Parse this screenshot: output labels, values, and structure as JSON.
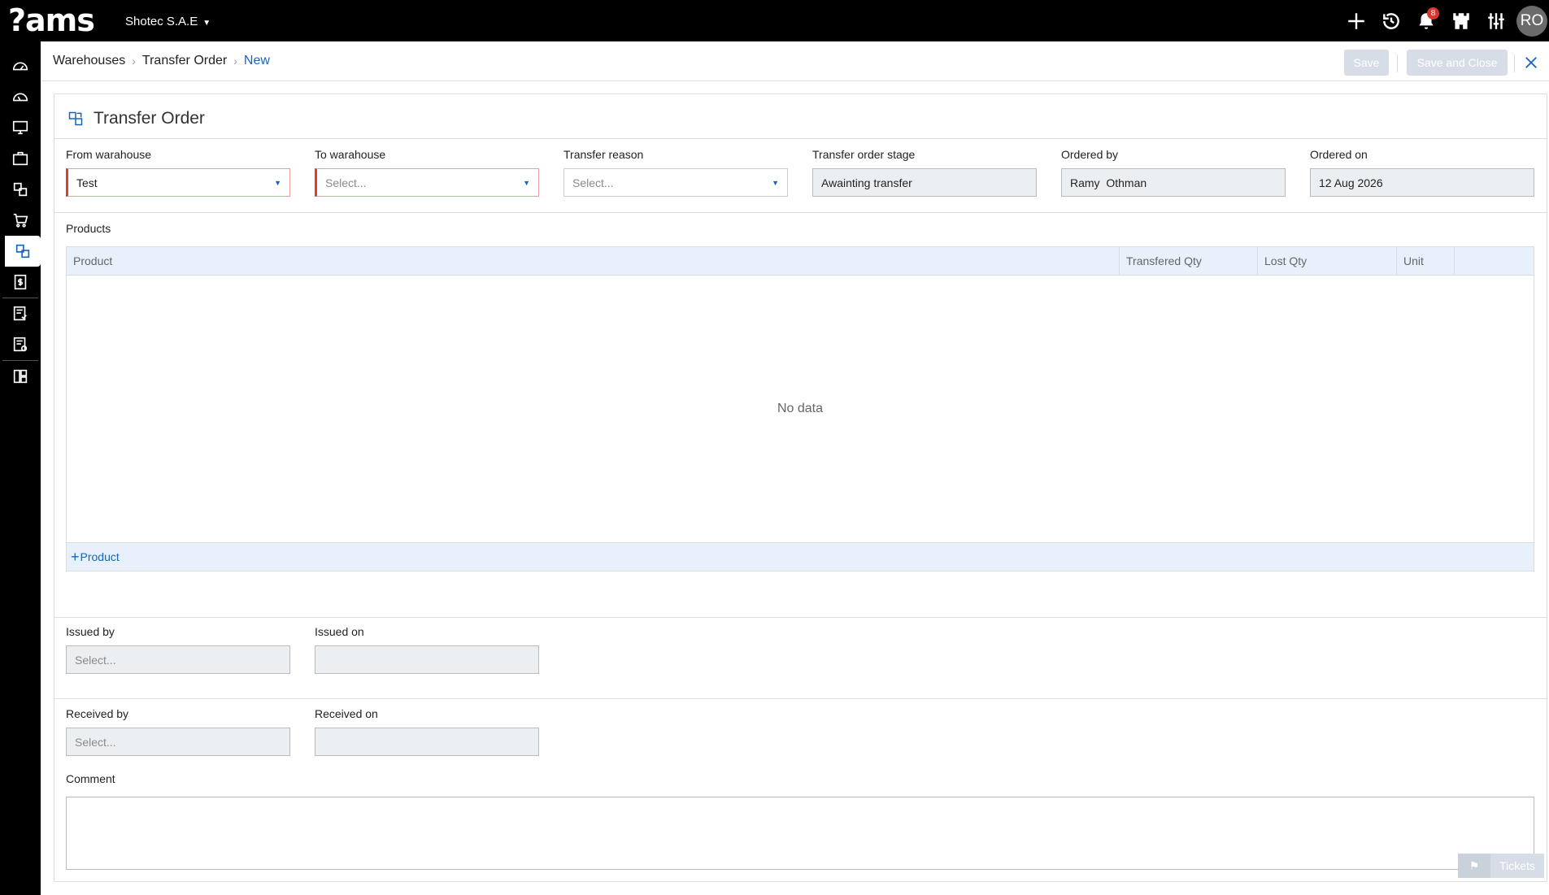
{
  "app": {
    "logo": "?ams",
    "company": "Shotec S.A.E",
    "avatar_initials": "RO",
    "notifications_count": "8"
  },
  "breadcrumb": {
    "items": [
      "Warehouses",
      "Transfer Order"
    ],
    "current": "New"
  },
  "toolbar": {
    "save_label": "Save",
    "save_close_label": "Save and Close"
  },
  "form": {
    "title": "Transfer Order",
    "from_warehouse": {
      "label": "From warahouse",
      "value": "Test"
    },
    "to_warehouse": {
      "label": "To warahouse",
      "placeholder": "Select..."
    },
    "transfer_reason": {
      "label": "Transfer reason",
      "placeholder": "Select..."
    },
    "stage": {
      "label": "Transfer order stage",
      "value": "Awainting transfer"
    },
    "ordered_by": {
      "label": "Ordered by",
      "value": "Ramy  Othman"
    },
    "ordered_on": {
      "label": "Ordered on",
      "value": "12 Aug 2026"
    }
  },
  "products": {
    "label": "Products",
    "columns": [
      "Product",
      "Transfered Qty",
      "Lost Qty",
      "Unit"
    ],
    "empty_text": "No data",
    "add_label": "Product"
  },
  "issue": {
    "issued_by": {
      "label": "Issued by",
      "placeholder": "Select..."
    },
    "issued_on": {
      "label": "Issued on",
      "value": ""
    }
  },
  "receive": {
    "received_by": {
      "label": "Received by",
      "placeholder": "Select..."
    },
    "received_on": {
      "label": "Received on",
      "value": ""
    }
  },
  "comment": {
    "label": "Comment"
  },
  "tickets": {
    "label": "Tickets"
  },
  "colors": {
    "accent": "#1565c0",
    "required": "#e53935",
    "header_bg": "#000000",
    "grid_header": "#e8f0fb"
  }
}
